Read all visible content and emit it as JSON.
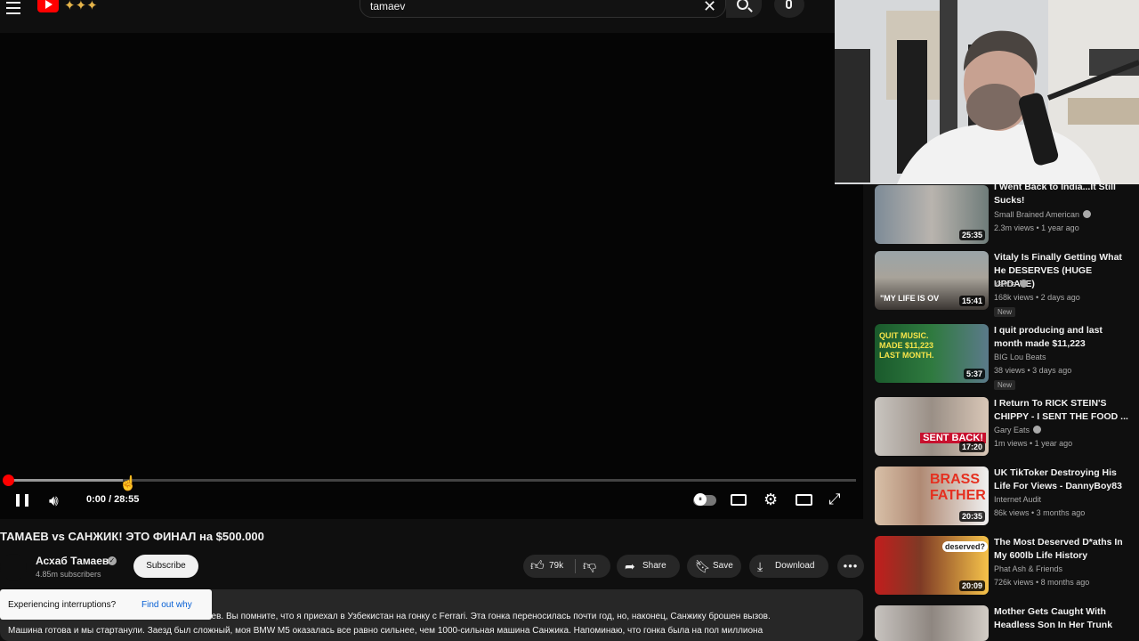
{
  "header": {
    "search_value": "tamaev"
  },
  "player": {
    "time_display": "0:00 / 28:55",
    "progress_fraction": 0.0
  },
  "video": {
    "title": "ТАМАЕВ vs САНЖИК! ЭТО ФИНАЛ на $500.000",
    "channel_name": "Асхаб Тамаев",
    "subscribers": "4.85m subscribers",
    "subscribe_label": "Subscribe",
    "likes": "79k",
    "share_label": "Share",
    "save_label": "Save",
    "download_label": "Download",
    "more_label": "•••"
  },
  "description": {
    "line1": "аев. Вы помните, что я приехал в Узбекистан на гонку с Ferrari. Эта гонка переносилась почти год, но, наконец, Санжику брошен вызов.",
    "line2": "Машина готова и мы стартанули. Заезд был сложный, моя BMW M5 оказалась все равно сильнее, чем 1000-сильная машина Санжика. Напоминаю, что гонка была на пол миллиона"
  },
  "toast": {
    "text": "Experiencing interruptions?",
    "link": "Find out why"
  },
  "recommendations": [
    {
      "title": "I Went Back to India...It Still Sucks!",
      "channel": "Small Brained American",
      "verified": true,
      "meta": "2.3m views • 1 year ago",
      "duration": "25:35",
      "new": false
    },
    {
      "title": "Vitaly Is Finally Getting What He DESERVES (HUGE UPDATE)",
      "channel": "Kavos",
      "verified": true,
      "meta": "168k views • 2 days ago",
      "duration": "15:41",
      "new": true,
      "thumb_text": "\"MY LIFE IS OV"
    },
    {
      "title": "I quit producing and last month made $11,223",
      "channel": "BIG Lou Beats",
      "verified": false,
      "meta": "38 views • 3 days ago",
      "duration": "5:37",
      "new": true,
      "thumb_text": "QUIT MUSIC. MADE $11,223 LAST MONTH."
    },
    {
      "title": "I Return To RICK STEIN'S CHIPPY - I SENT THE FOOD ...",
      "channel": "Gary Eats",
      "verified": true,
      "meta": "1m views • 1 year ago",
      "duration": "17:20",
      "new": false,
      "thumb_text": "SENT BACK!"
    },
    {
      "title": "UK TikToker Destroying His Life For Views - DannyBoy83",
      "channel": "Internet Audit",
      "verified": false,
      "meta": "86k views • 3 months ago",
      "duration": "20:35",
      "new": false,
      "thumb_text": "BRASS FATHER"
    },
    {
      "title": "The Most Deserved D*aths In My 600lb Life History",
      "channel": "Phat Ash & Friends",
      "verified": false,
      "meta": "726k views • 8 months ago",
      "duration": "20:09",
      "new": false,
      "thumb_text": "deserved?"
    },
    {
      "title": "Mother Gets Caught With Headless Son In Her Trunk",
      "channel": "",
      "verified": false,
      "meta": "",
      "duration": "",
      "new": false
    }
  ],
  "new_badge": "New",
  "colors": {
    "background": "#0f0f0f",
    "accent_red": "#ff0000",
    "surface": "#272727",
    "link_blue": "#065fd4"
  }
}
